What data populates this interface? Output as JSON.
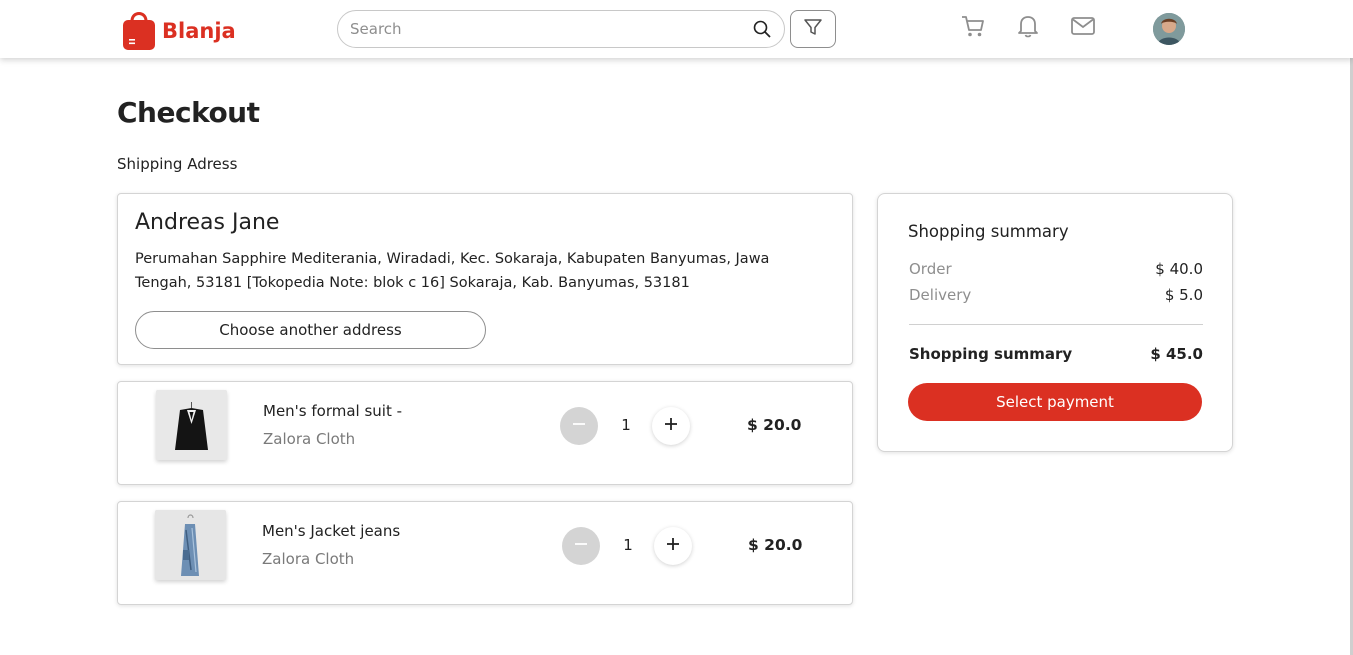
{
  "brand": {
    "name": "Blanja",
    "color": "#DB3022"
  },
  "header": {
    "search_placeholder": "Search",
    "icons": [
      "search-icon",
      "filter-icon",
      "cart-icon",
      "bell-icon",
      "mail-icon"
    ]
  },
  "page": {
    "title": "Checkout",
    "shipping_label": "Shipping Adress"
  },
  "address": {
    "name": "Andreas Jane",
    "text": "Perumahan Sapphire Mediterania, Wiradadi, Kec. Sokaraja, Kabupaten Banyumas, Jawa Tengah, 53181 [Tokopedia Note: blok c 16] Sokaraja, Kab. Banyumas, 53181",
    "change_button": "Choose another address"
  },
  "items": [
    {
      "name": "Men's formal suit -",
      "brand": "Zalora Cloth",
      "quantity": "1",
      "price": "$ 20.0"
    },
    {
      "name": "Men's Jacket jeans",
      "brand": "Zalora Cloth",
      "quantity": "1",
      "price": "$ 20.0"
    }
  ],
  "summary": {
    "title": "Shopping summary",
    "order_label": "Order",
    "order_value": "$ 40.0",
    "delivery_label": "Delivery",
    "delivery_value": "$ 5.0",
    "total_label": "Shopping summary",
    "total_value": "$ 45.0",
    "pay_button": "Select payment"
  }
}
